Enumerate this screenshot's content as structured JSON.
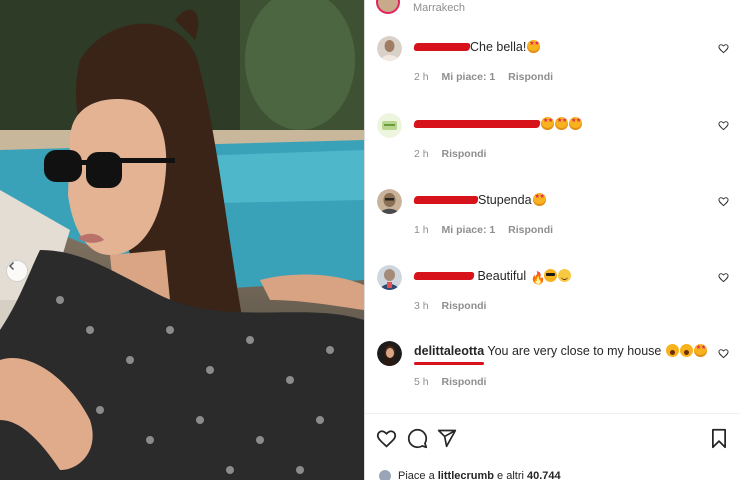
{
  "photo": {
    "prev_icon": "chevron-left-icon"
  },
  "post": {
    "location": "Marrakech"
  },
  "comments": [
    {
      "username": "",
      "text": "Che bella!",
      "emojis": [
        "starstruck"
      ],
      "time": "2 h",
      "likes": "Mi piace: 1",
      "reply": "Rispondi",
      "avatar_color": "#d9d0c7"
    },
    {
      "username": "",
      "text": "",
      "emojis": [
        "starstruck",
        "starstruck",
        "starstruck"
      ],
      "time": "2 h",
      "likes": "",
      "reply": "Rispondi",
      "avatar_color": "#b8d68f"
    },
    {
      "username": "",
      "text": "Stupenda",
      "emojis": [
        "starstruck"
      ],
      "time": "1 h",
      "likes": "Mi piace: 1",
      "reply": "Rispondi",
      "avatar_color": "#8b6f55"
    },
    {
      "username": "",
      "text": " Beautiful ",
      "emojis": [
        "fire",
        "cool",
        "smile"
      ],
      "time": "3 h",
      "likes": "",
      "reply": "Rispondi",
      "avatar_color": "#7b8797"
    },
    {
      "username": "delittaleotta",
      "text": " You are very close to my house ",
      "emojis": [
        "shock",
        "shock",
        "starstruck"
      ],
      "time": "5 h",
      "likes": "",
      "reply": "Rispondi",
      "avatar_color": "#2a2a2a"
    }
  ],
  "actions": {
    "like_icon": "heart-icon",
    "comment_icon": "comment-icon",
    "share_icon": "send-icon",
    "save_icon": "bookmark-icon"
  },
  "likes_summary": {
    "prefix": "Piace a ",
    "user": "littlecrumb",
    "suffix": " e altri ",
    "count": "40.744"
  },
  "colors": {
    "redaction": "#d8121b",
    "meta_gray": "#8e8e8e",
    "text": "#262626"
  }
}
